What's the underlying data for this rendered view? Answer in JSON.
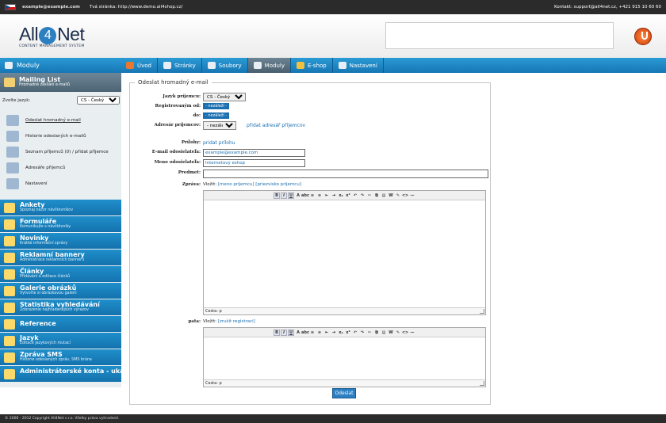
{
  "topbar": {
    "email": "example@example.com",
    "site_label": "Tvá stránka: http://www.demo.all4shop.cz/",
    "contact": "Kontakt: support@all4net.cz, +421 915 10 60 60"
  },
  "header": {
    "logo_left": "All",
    "logo_mid": "4",
    "logo_right": "Net",
    "logo_sub": "CONTENT MANAGEMENT SYSTEM"
  },
  "nav": {
    "section": "Moduly",
    "tabs": [
      {
        "label": "Úvod"
      },
      {
        "label": "Stránky"
      },
      {
        "label": "Soubory"
      },
      {
        "label": "Moduly"
      },
      {
        "label": "E-shop"
      },
      {
        "label": "Nastavení"
      }
    ]
  },
  "sidebar": {
    "module_title": "Mailing List",
    "module_sub": "Hromadné zasílání e-mailů",
    "lang_label": "Zvolte jazyk:",
    "lang_value": "CS - Český",
    "items": [
      {
        "label": "Odeslat hromadný e-mail"
      },
      {
        "label": "Historie odeslaných e-mailů"
      },
      {
        "label": "Seznam příjemců (0) / přidat příjemce"
      },
      {
        "label": "Adresáře příjemců"
      },
      {
        "label": "Nastavení"
      }
    ],
    "modules": [
      {
        "title": "Ankety",
        "sub": "Spoznaj názor návštevníkov"
      },
      {
        "title": "Formuláře",
        "sub": "Komunikujte s návštěvníky"
      },
      {
        "title": "Novinky",
        "sub": "Krátké informační zprávy"
      },
      {
        "title": "Reklamní bannery",
        "sub": "Administrace reklamních bannerů"
      },
      {
        "title": "Články",
        "sub": "Přidávání a editace článků"
      },
      {
        "title": "Galerie obrázků",
        "sub": "Vytvořte si obrázkovou galerii"
      },
      {
        "title": "Statistika vyhledávání",
        "sub": "Zobrazenie najhľadanejších výrazov"
      },
      {
        "title": "Reference",
        "sub": ""
      },
      {
        "title": "Jazyk",
        "sub": "Editace Jazykových mutací"
      },
      {
        "title": "Zpráva SMS",
        "sub": "Historie odeslaných zpráv, SMS brána"
      },
      {
        "title": "Administrátorské konta - ukážka",
        "sub": ""
      }
    ]
  },
  "form": {
    "legend": "Odeslat hromadný e-mail",
    "lang_label": "Jazyk príjemcu:",
    "lang_value": "CS - Český",
    "reg_from_label": "Registrovaným od:",
    "reg_from_value": "- nezáleží -",
    "reg_to_label": "do:",
    "reg_to_value": "- nezáleží -",
    "dir_label": "Adresár príjemcov:",
    "dir_value": "- nezáleží -",
    "dir_link": "přidat adresář příjemcov",
    "attach_label": "Prílohy:",
    "attach_link": "pridat prílohu",
    "email_label": "E-mail odosielateľa:",
    "email_value": "example@example.com",
    "name_label": "Meno odosielateľa:",
    "name_value": "Internetový eshop",
    "subject_label": "Predmet:",
    "subject_value": "",
    "message_label": "Zpráva:",
    "insert_prefix": "Vložit:",
    "insert_name": "[meno príjemcu]",
    "insert_surname": "[priezvisko príjemcu]",
    "status_text": "Cesta: p",
    "footer_label": "pata:",
    "insert_unreg": "[zrušit registraci]",
    "submit": "Odeslat"
  },
  "footer": {
    "text": "© 2006 - 2012 Copyright All4Net c.r.o. Všetky práva vyhradené."
  }
}
